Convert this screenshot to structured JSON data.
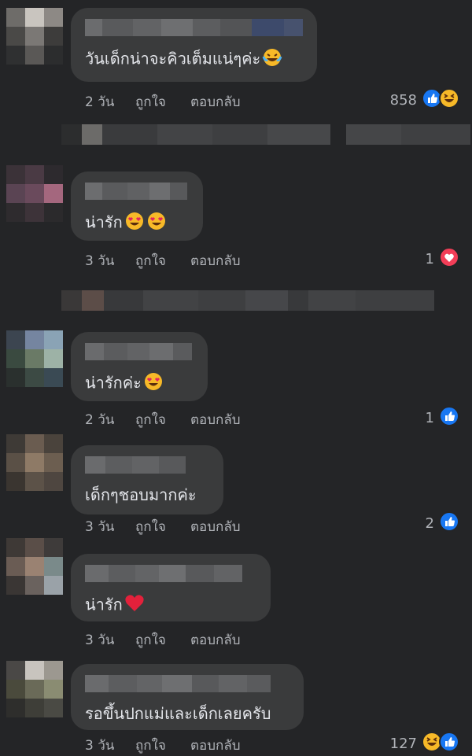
{
  "actions": {
    "like_label": "ถูกใจ",
    "reply_label": "ตอบกลับ"
  },
  "comments": [
    {
      "text": "วันเด็กน่าจะคิวเต็มแน่ๆค่ะ",
      "emoji": "laugh-tears",
      "time": "2 วัน",
      "reaction_count": "858",
      "reactions": [
        "like",
        "haha"
      ]
    },
    {
      "text": "น่ารัก",
      "emoji": "heart-eyes-x2",
      "time": "3 วัน",
      "reaction_count": "1",
      "reactions": [
        "love"
      ]
    },
    {
      "text": "น่ารักค่ะ",
      "emoji": "heart-eyes",
      "time": "2 วัน",
      "reaction_count": "1",
      "reactions": [
        "like"
      ]
    },
    {
      "text": "เด็กๆชอบมากค่ะ",
      "emoji": "",
      "time": "3 วัน",
      "reaction_count": "2",
      "reactions": [
        "like"
      ]
    },
    {
      "text": "น่ารัก",
      "emoji": "red-heart",
      "time": "3 วัน",
      "reaction_count": "",
      "reactions": []
    },
    {
      "text": "รอขึ้นปกแม่และเด็กเลยครับ",
      "emoji": "",
      "time": "3 วัน",
      "reaction_count": "127",
      "reactions": [
        "haha",
        "like"
      ]
    }
  ],
  "colors": {
    "background": "#242527",
    "bubble": "#3a3b3c",
    "like_blue": "#1877f2",
    "love_red": "#f33e58",
    "haha_yellow": "#f7b928"
  }
}
